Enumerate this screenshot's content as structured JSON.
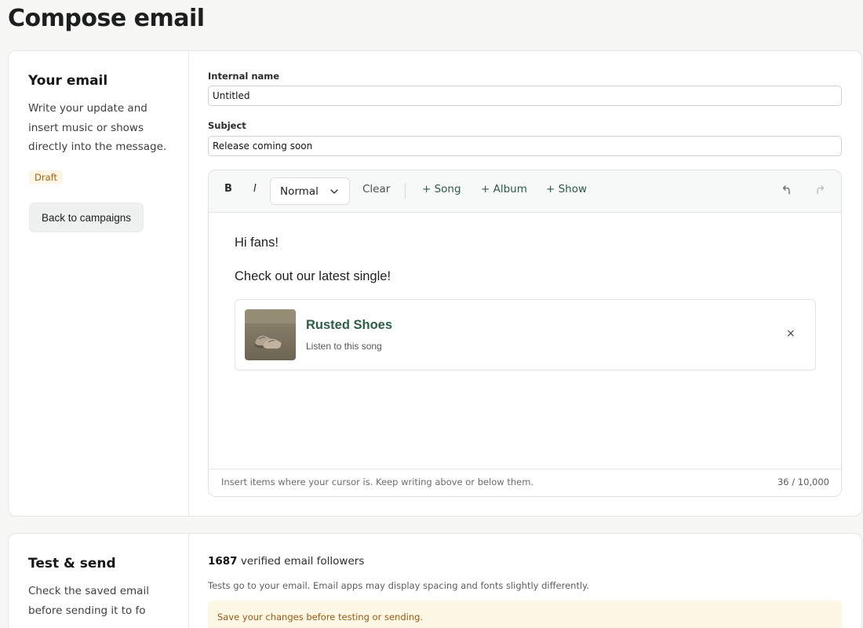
{
  "page": {
    "title": "Compose email"
  },
  "email_section": {
    "title": "Your email",
    "description": "Write your update and insert music or shows directly into the message.",
    "status_badge": "Draft",
    "back_button": "Back to campaigns"
  },
  "form": {
    "internal_name": {
      "label": "Internal name",
      "value": "Untitled"
    },
    "subject": {
      "label": "Subject",
      "value": "Release coming soon"
    }
  },
  "toolbar": {
    "bold": "B",
    "italic": "I",
    "format_select": "Normal",
    "clear": "Clear",
    "add_song": "+ Song",
    "add_album": "+ Album",
    "add_show": "+ Show"
  },
  "editor": {
    "paragraphs": [
      "Hi fans!",
      "Check out our latest single!"
    ],
    "embed": {
      "title": "Rusted Shoes",
      "subtitle": "Listen to this song",
      "remove": "×"
    },
    "hint": "Insert items where your cursor is. Keep writing above or below them.",
    "counter": "36 / 10,000"
  },
  "send_section": {
    "title": "Test & send",
    "description": "Check the saved email before sending it to fo",
    "followers_count": "1687",
    "followers_text": " verified email followers",
    "tests_note": "Tests go to your email. Email apps may display spacing and fonts slightly differently.",
    "warning": "Save your changes before testing or sending."
  },
  "colors": {
    "accent_green": "#2b5b45",
    "draft_badge": "#a0620e",
    "warning_bg": "#fdf8e6"
  },
  "icons": {
    "format_chevron": "chevron-down-icon",
    "undo": "undo-icon",
    "redo": "redo-icon",
    "remove_embed": "close-icon"
  }
}
